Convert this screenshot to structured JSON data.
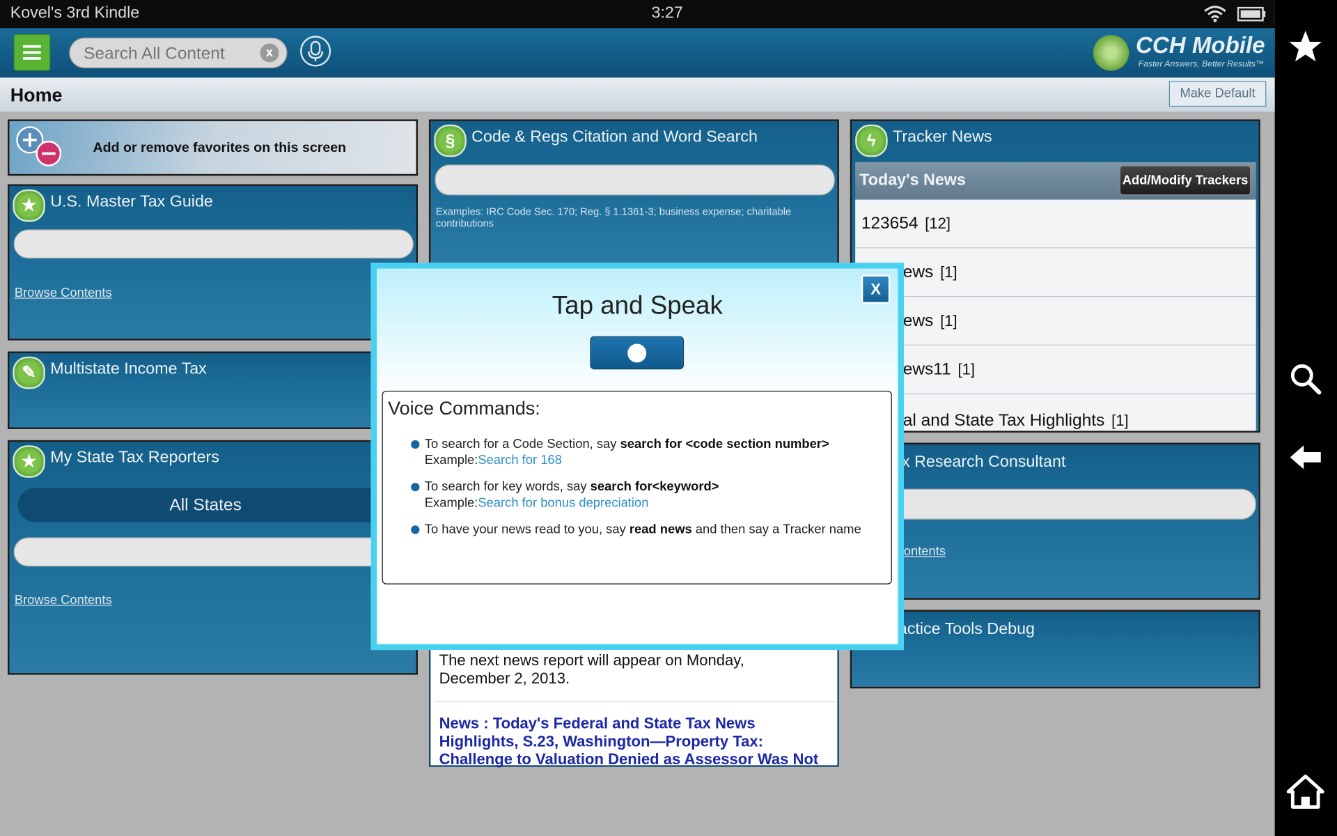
{
  "status_bar": {
    "device_name": "Kovel's 3rd Kindle",
    "time": "3:27"
  },
  "header": {
    "search_placeholder": "Search All Content",
    "logo_title": "CCH Mobile",
    "logo_tagline": "Faster Answers, Better Results™"
  },
  "home_bar": {
    "title": "Home",
    "make_default_label": "Make Default"
  },
  "favorites_prompt": "Add or remove favorites on this screen",
  "widgets": {
    "master_tax_guide": {
      "title": "U.S. Master Tax Guide",
      "browse_label": "Browse Contents"
    },
    "multistate": {
      "title": "Multistate Income Tax"
    },
    "state_reporters": {
      "title": "My State Tax Reporters",
      "selector_label": "All States",
      "browse_label": "Browse Contents"
    },
    "code_regs": {
      "title": "Code & Regs Citation and Word Search",
      "examples": "Examples: IRC Code Sec. 170; Reg. § 1.1361-3; business expense; charitable contributions"
    },
    "tracker_news": {
      "title": "Tracker News",
      "section_label": "Today's News",
      "add_modify_label": "Add/Modify Trackers",
      "items": [
        {
          "name": "123654",
          "count": "[12]"
        },
        {
          "name": "ews",
          "count": "[1]"
        },
        {
          "name": "ews",
          "count": "[1]"
        },
        {
          "name": "ews11",
          "count": "[1]"
        },
        {
          "name": "al and State Tax Highlights",
          "count": "[1]"
        }
      ]
    },
    "tax_research": {
      "title": "ax Research Consultant",
      "browse_label": " Contents"
    },
    "practice_tools": {
      "title": "ractice Tools Debug"
    },
    "news_panel": {
      "next_report": "The next news report will appear on Monday, December 2, 2013.",
      "headline": "News : Today's Federal and State Tax News Highlights, S.23, Washington—Property Tax: Challenge to Valuation Denied as Assessor Was Not"
    }
  },
  "dialog": {
    "title": "Tap and Speak",
    "close_label": "X",
    "voice_commands_heading": "Voice Commands:",
    "commands": [
      {
        "text": "To search for a Code Section, say ",
        "keyword": "search for <code section number>",
        "example_label": "Example:",
        "example": "Search for 168"
      },
      {
        "text": "To search for key words, say ",
        "keyword": "search for<keyword>",
        "example_label": "Example:",
        "example": "Search for bonus depreciation"
      },
      {
        "text": "To have your news read to you, say ",
        "keyword": "read news",
        "suffix": " and then say a Tracker name"
      }
    ]
  },
  "icons": [
    "menu-icon",
    "clear-icon",
    "microphone-icon",
    "cch-logo-icon",
    "star-icon",
    "search-icon",
    "back-icon",
    "home-icon",
    "wifi-icon",
    "battery-icon",
    "favorites-edit-icon",
    "section-icon",
    "lightning-icon"
  ],
  "colors": {
    "accent_blue": "#1b6c98",
    "menu_green": "#5ab536",
    "dialog_border": "#49d1f2",
    "link_blue": "#2a8fc9"
  }
}
